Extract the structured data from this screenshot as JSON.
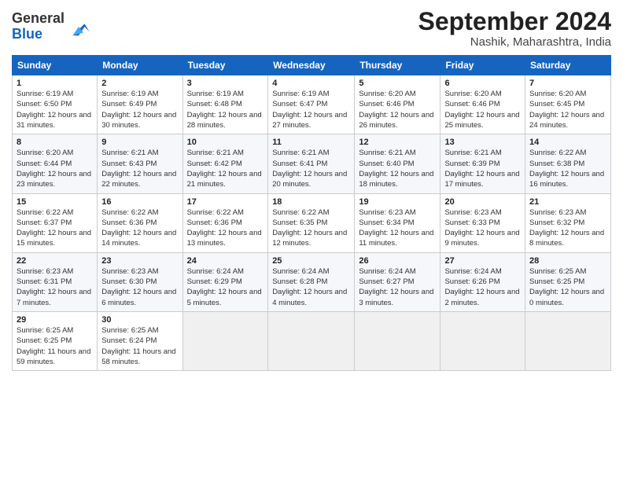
{
  "logo": {
    "general": "General",
    "blue": "Blue"
  },
  "header": {
    "month": "September 2024",
    "location": "Nashik, Maharashtra, India"
  },
  "weekdays": [
    "Sunday",
    "Monday",
    "Tuesday",
    "Wednesday",
    "Thursday",
    "Friday",
    "Saturday"
  ],
  "weeks": [
    [
      {
        "day": "1",
        "sunrise": "Sunrise: 6:19 AM",
        "sunset": "Sunset: 6:50 PM",
        "daylight": "Daylight: 12 hours and 31 minutes."
      },
      {
        "day": "2",
        "sunrise": "Sunrise: 6:19 AM",
        "sunset": "Sunset: 6:49 PM",
        "daylight": "Daylight: 12 hours and 30 minutes."
      },
      {
        "day": "3",
        "sunrise": "Sunrise: 6:19 AM",
        "sunset": "Sunset: 6:48 PM",
        "daylight": "Daylight: 12 hours and 28 minutes."
      },
      {
        "day": "4",
        "sunrise": "Sunrise: 6:19 AM",
        "sunset": "Sunset: 6:47 PM",
        "daylight": "Daylight: 12 hours and 27 minutes."
      },
      {
        "day": "5",
        "sunrise": "Sunrise: 6:20 AM",
        "sunset": "Sunset: 6:46 PM",
        "daylight": "Daylight: 12 hours and 26 minutes."
      },
      {
        "day": "6",
        "sunrise": "Sunrise: 6:20 AM",
        "sunset": "Sunset: 6:46 PM",
        "daylight": "Daylight: 12 hours and 25 minutes."
      },
      {
        "day": "7",
        "sunrise": "Sunrise: 6:20 AM",
        "sunset": "Sunset: 6:45 PM",
        "daylight": "Daylight: 12 hours and 24 minutes."
      }
    ],
    [
      {
        "day": "8",
        "sunrise": "Sunrise: 6:20 AM",
        "sunset": "Sunset: 6:44 PM",
        "daylight": "Daylight: 12 hours and 23 minutes."
      },
      {
        "day": "9",
        "sunrise": "Sunrise: 6:21 AM",
        "sunset": "Sunset: 6:43 PM",
        "daylight": "Daylight: 12 hours and 22 minutes."
      },
      {
        "day": "10",
        "sunrise": "Sunrise: 6:21 AM",
        "sunset": "Sunset: 6:42 PM",
        "daylight": "Daylight: 12 hours and 21 minutes."
      },
      {
        "day": "11",
        "sunrise": "Sunrise: 6:21 AM",
        "sunset": "Sunset: 6:41 PM",
        "daylight": "Daylight: 12 hours and 20 minutes."
      },
      {
        "day": "12",
        "sunrise": "Sunrise: 6:21 AM",
        "sunset": "Sunset: 6:40 PM",
        "daylight": "Daylight: 12 hours and 18 minutes."
      },
      {
        "day": "13",
        "sunrise": "Sunrise: 6:21 AM",
        "sunset": "Sunset: 6:39 PM",
        "daylight": "Daylight: 12 hours and 17 minutes."
      },
      {
        "day": "14",
        "sunrise": "Sunrise: 6:22 AM",
        "sunset": "Sunset: 6:38 PM",
        "daylight": "Daylight: 12 hours and 16 minutes."
      }
    ],
    [
      {
        "day": "15",
        "sunrise": "Sunrise: 6:22 AM",
        "sunset": "Sunset: 6:37 PM",
        "daylight": "Daylight: 12 hours and 15 minutes."
      },
      {
        "day": "16",
        "sunrise": "Sunrise: 6:22 AM",
        "sunset": "Sunset: 6:36 PM",
        "daylight": "Daylight: 12 hours and 14 minutes."
      },
      {
        "day": "17",
        "sunrise": "Sunrise: 6:22 AM",
        "sunset": "Sunset: 6:36 PM",
        "daylight": "Daylight: 12 hours and 13 minutes."
      },
      {
        "day": "18",
        "sunrise": "Sunrise: 6:22 AM",
        "sunset": "Sunset: 6:35 PM",
        "daylight": "Daylight: 12 hours and 12 minutes."
      },
      {
        "day": "19",
        "sunrise": "Sunrise: 6:23 AM",
        "sunset": "Sunset: 6:34 PM",
        "daylight": "Daylight: 12 hours and 11 minutes."
      },
      {
        "day": "20",
        "sunrise": "Sunrise: 6:23 AM",
        "sunset": "Sunset: 6:33 PM",
        "daylight": "Daylight: 12 hours and 9 minutes."
      },
      {
        "day": "21",
        "sunrise": "Sunrise: 6:23 AM",
        "sunset": "Sunset: 6:32 PM",
        "daylight": "Daylight: 12 hours and 8 minutes."
      }
    ],
    [
      {
        "day": "22",
        "sunrise": "Sunrise: 6:23 AM",
        "sunset": "Sunset: 6:31 PM",
        "daylight": "Daylight: 12 hours and 7 minutes."
      },
      {
        "day": "23",
        "sunrise": "Sunrise: 6:23 AM",
        "sunset": "Sunset: 6:30 PM",
        "daylight": "Daylight: 12 hours and 6 minutes."
      },
      {
        "day": "24",
        "sunrise": "Sunrise: 6:24 AM",
        "sunset": "Sunset: 6:29 PM",
        "daylight": "Daylight: 12 hours and 5 minutes."
      },
      {
        "day": "25",
        "sunrise": "Sunrise: 6:24 AM",
        "sunset": "Sunset: 6:28 PM",
        "daylight": "Daylight: 12 hours and 4 minutes."
      },
      {
        "day": "26",
        "sunrise": "Sunrise: 6:24 AM",
        "sunset": "Sunset: 6:27 PM",
        "daylight": "Daylight: 12 hours and 3 minutes."
      },
      {
        "day": "27",
        "sunrise": "Sunrise: 6:24 AM",
        "sunset": "Sunset: 6:26 PM",
        "daylight": "Daylight: 12 hours and 2 minutes."
      },
      {
        "day": "28",
        "sunrise": "Sunrise: 6:25 AM",
        "sunset": "Sunset: 6:25 PM",
        "daylight": "Daylight: 12 hours and 0 minutes."
      }
    ],
    [
      {
        "day": "29",
        "sunrise": "Sunrise: 6:25 AM",
        "sunset": "Sunset: 6:25 PM",
        "daylight": "Daylight: 11 hours and 59 minutes."
      },
      {
        "day": "30",
        "sunrise": "Sunrise: 6:25 AM",
        "sunset": "Sunset: 6:24 PM",
        "daylight": "Daylight: 11 hours and 58 minutes."
      },
      null,
      null,
      null,
      null,
      null
    ]
  ]
}
